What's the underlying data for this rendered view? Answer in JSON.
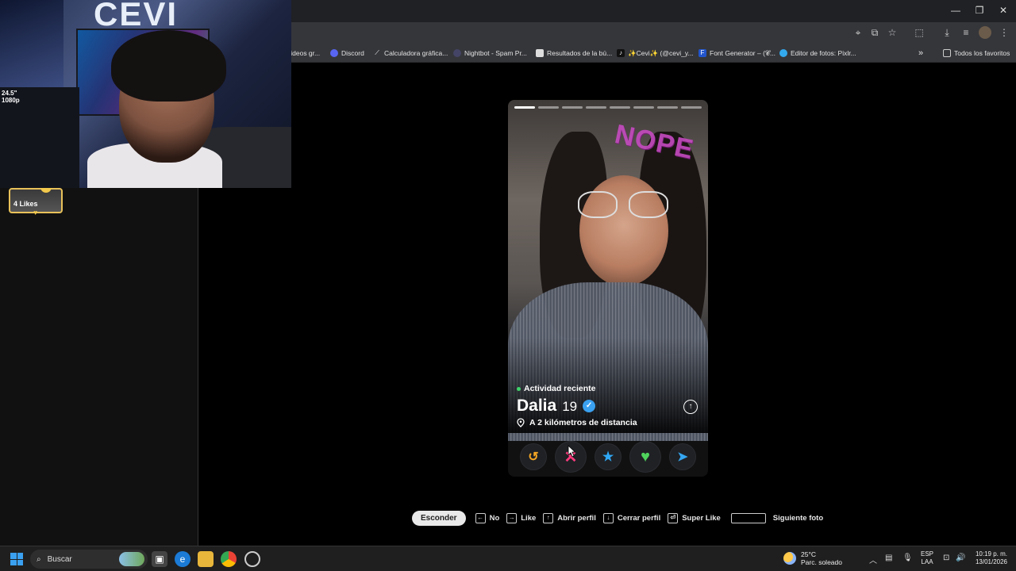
{
  "window": {
    "minimize": "—",
    "restore": "❐",
    "close": "✕"
  },
  "toolbar_icons": [
    "location-icon",
    "install-icon",
    "star-icon",
    "extensions-icon",
    "download-icon",
    "media-icon",
    "profile-icon",
    "menu-icon"
  ],
  "bookmarks": [
    {
      "label": "videos gr...",
      "icon": "video-icon",
      "color": "#888888"
    },
    {
      "label": "Discord",
      "icon": "discord-icon",
      "color": "#5865f2"
    },
    {
      "label": "Calculadora gráfica...",
      "icon": "graph-icon",
      "color": "#666666"
    },
    {
      "label": "Nightbot - Spam Pr...",
      "icon": "nightbot-icon",
      "color": "#444466"
    },
    {
      "label": "Resultados de la bú...",
      "icon": "doc-icon",
      "color": "#dddddd"
    },
    {
      "label": "✨Cevi✨ (@cevi_y...",
      "icon": "tiktok-icon",
      "color": "#111111"
    },
    {
      "label": "Font Generator – (𝓒...",
      "icon": "font-icon",
      "color": "#2255cc"
    },
    {
      "label": "Editor de fotos: Pixlr...",
      "icon": "pixlr-icon",
      "color": "#33aaee"
    }
  ],
  "bookmarks_more": "»",
  "all_bookmarks": "Todos los favoritos",
  "webcam": {
    "logo": "CEVI",
    "spec_line1": "24.5\"",
    "spec_line2": "1080p"
  },
  "sidebar": {
    "likes_label": "4 Likes"
  },
  "profile": {
    "photo_count": 8,
    "current_photo": 1,
    "sticker_text": "NOPE",
    "activity": "Actividad reciente",
    "name": "Dalia",
    "age": "19",
    "verified_glyph": "✓",
    "distance": "A 2 kilómetros de distancia",
    "info_glyph": "↑"
  },
  "actions": [
    {
      "name": "rewind-button",
      "glyph": "↺",
      "color": "#f5a623",
      "size": "sm"
    },
    {
      "name": "nope-button",
      "glyph": "✕",
      "color": "#ff3c7e",
      "size": "lg"
    },
    {
      "name": "super-like-button",
      "glyph": "★",
      "color": "#2fa8f5",
      "size": "sm"
    },
    {
      "name": "like-button",
      "glyph": "♥",
      "color": "#4fd35c",
      "size": "lg"
    },
    {
      "name": "boost-button",
      "glyph": "➤",
      "color": "#35a6f0",
      "size": "sm"
    }
  ],
  "shortcuts": {
    "hide": "Esconder",
    "items": [
      {
        "key": "←",
        "label": "No"
      },
      {
        "key": "→",
        "label": "Like"
      },
      {
        "key": "↑",
        "label": "Abrir perfil"
      },
      {
        "key": "↓",
        "label": "Cerrar perfil"
      },
      {
        "key": "⏎",
        "label": "Super Like"
      },
      {
        "key": "",
        "label": "Siguiente foto",
        "wide": true
      }
    ]
  },
  "taskbar": {
    "search_placeholder": "Buscar",
    "temperature": "25°C",
    "weather": "Parc. soleado",
    "lang_top": "ESP",
    "lang_bottom": "LAA",
    "time": "10:19 p. m.",
    "date": "13/01/2026"
  }
}
